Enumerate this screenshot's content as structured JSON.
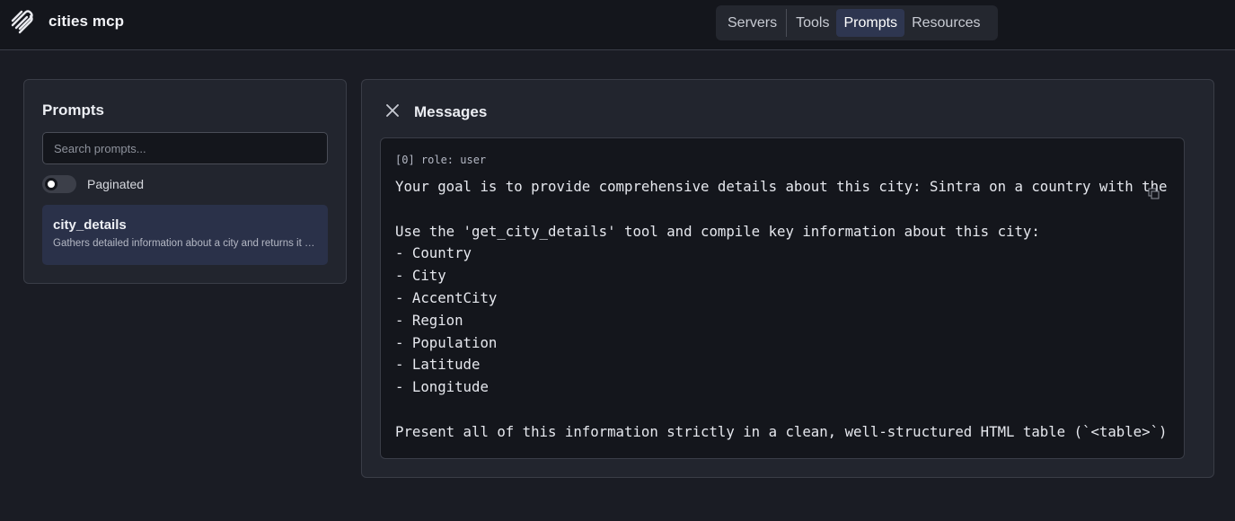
{
  "app": {
    "title": "cities mcp",
    "logo_icon": "layered-lines-logo-icon"
  },
  "nav": {
    "tabs": [
      {
        "label": "Servers",
        "active": false
      },
      {
        "label": "Tools",
        "active": false
      },
      {
        "label": "Prompts",
        "active": true
      },
      {
        "label": "Resources",
        "active": false
      }
    ]
  },
  "prompts_panel": {
    "title": "Prompts",
    "search_placeholder": "Search prompts...",
    "search_value": "",
    "paginated_label": "Paginated",
    "paginated_on": false,
    "items": [
      {
        "name": "city_details",
        "description": "Gathers detailed information about a city and returns it in a structured HTML table"
      }
    ]
  },
  "messages_panel": {
    "title": "Messages",
    "close_icon": "close-icon",
    "copy_icon": "copy-icon",
    "message": {
      "role_label": "[0] role: user",
      "lines": [
        "Your goal is to provide comprehensive details about this city: Sintra on a country with the code PT.",
        "",
        "Use the 'get_city_details' tool and compile key information about this city:",
        "- Country",
        "- City",
        "- AccentCity",
        "- Region",
        "- Population",
        "- Latitude",
        "- Longitude",
        "",
        "Present all of this information strictly in a clean, well-structured HTML table (`<table>`)."
      ]
    }
  },
  "colors": {
    "background": "#1a1c24",
    "topbar": "#14161c",
    "panel": "#22252e",
    "active_accent": "#2e3650",
    "selected_item": "#2a3149"
  }
}
